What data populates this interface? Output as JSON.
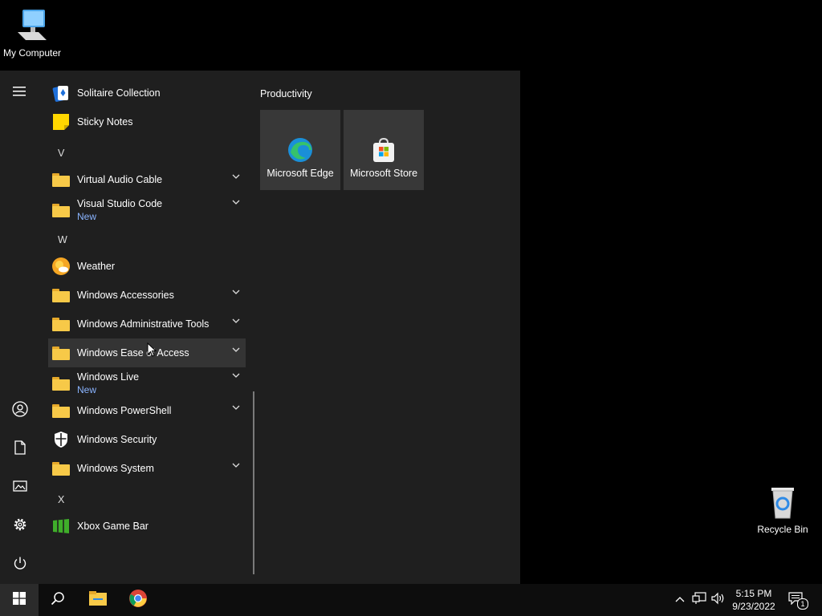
{
  "desktop": {
    "icons": [
      {
        "label": "My Computer",
        "icon": "computer-icon"
      },
      {
        "label": "Recycle Bin",
        "icon": "recycle-bin-icon"
      }
    ]
  },
  "start_menu": {
    "letters": {
      "v": "V",
      "w": "W",
      "x": "X"
    },
    "apps": {
      "solitaire": {
        "label": "Solitaire Collection",
        "icon": "solitaire-icon"
      },
      "sticky": {
        "label": "Sticky Notes",
        "icon": "sticky-notes-icon"
      },
      "vac": {
        "label": "Virtual Audio Cable",
        "icon": "folder-icon"
      },
      "vscode": {
        "label": "Visual Studio Code",
        "badge": "New",
        "icon": "folder-icon"
      },
      "weather": {
        "label": "Weather",
        "icon": "weather-icon"
      },
      "accessories": {
        "label": "Windows Accessories",
        "icon": "folder-icon"
      },
      "admin": {
        "label": "Windows Administrative Tools",
        "icon": "folder-icon"
      },
      "ease": {
        "label": "Windows Ease of Access",
        "icon": "folder-icon"
      },
      "live": {
        "label": "Windows Live",
        "badge": "New",
        "icon": "folder-icon"
      },
      "powershell": {
        "label": "Windows PowerShell",
        "icon": "folder-icon"
      },
      "security": {
        "label": "Windows Security",
        "icon": "shield-icon"
      },
      "system": {
        "label": "Windows System",
        "icon": "folder-icon"
      },
      "xbox": {
        "label": "Xbox Game Bar",
        "icon": "xbox-game-bar-icon"
      }
    },
    "group": {
      "title": "Productivity",
      "tiles": [
        {
          "label": "Microsoft Edge",
          "icon": "edge-icon"
        },
        {
          "label": "Microsoft Store",
          "icon": "store-icon"
        }
      ]
    }
  },
  "taskbar": {
    "clock": {
      "time": "5:15 PM",
      "date": "9/23/2022"
    },
    "notification_count": "1",
    "accent": "#f7c948"
  }
}
